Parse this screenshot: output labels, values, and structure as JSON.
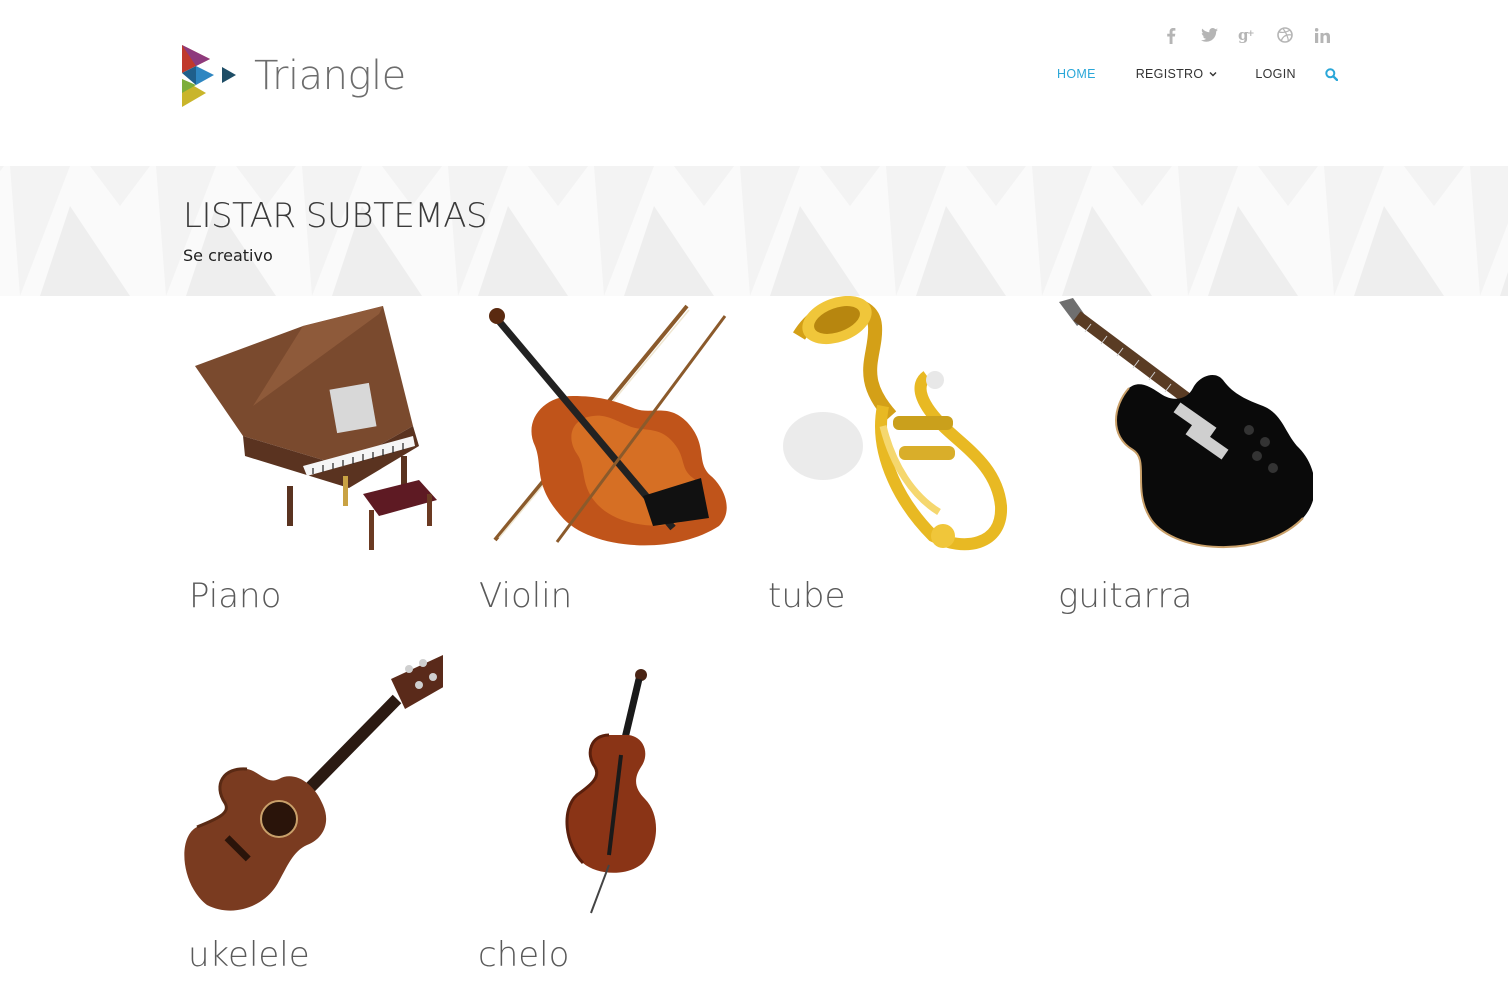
{
  "brand": {
    "name": "Triangle"
  },
  "social": [
    {
      "icon": "facebook-icon",
      "glyph": "f"
    },
    {
      "icon": "twitter-icon",
      "glyph": "t"
    },
    {
      "icon": "google-plus-icon",
      "glyph": "g+"
    },
    {
      "icon": "dribbble-icon",
      "glyph": "◎"
    },
    {
      "icon": "linkedin-icon",
      "glyph": "in"
    }
  ],
  "nav": {
    "home": "HOME",
    "registro": "REGISTRO",
    "login": "LOGIN"
  },
  "colors": {
    "accent": "#2aa7d8",
    "text": "#333333",
    "label": "#5a5a5a",
    "icon": "#b5b5b5"
  },
  "page": {
    "title": "LISTAR SUBTEMAS",
    "subtitle": "Se creativo"
  },
  "items": [
    {
      "label": "Piano",
      "icon": "piano-image"
    },
    {
      "label": "Violin",
      "icon": "violin-image"
    },
    {
      "label": "tube",
      "icon": "tuba-image"
    },
    {
      "label": "guitarra",
      "icon": "guitar-image"
    },
    {
      "label": "ukelele",
      "icon": "ukulele-image"
    },
    {
      "label": "chelo",
      "icon": "cello-image"
    }
  ]
}
